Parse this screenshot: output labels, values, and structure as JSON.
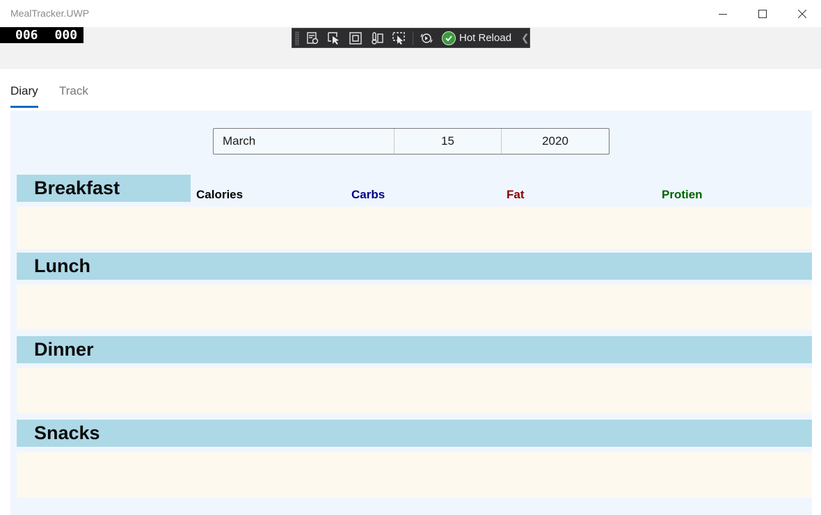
{
  "window": {
    "title": "MealTracker.UWP",
    "controls": [
      "minimize",
      "maximize",
      "close"
    ]
  },
  "frame_counter": {
    "left": "006",
    "right": "000"
  },
  "dev_toolbar": {
    "icons": [
      "live-visual-tree-icon",
      "select-element-icon",
      "display-layout-adorners-icon",
      "track-focus-icon",
      "binding-failures-icon",
      "hot-reload-status-icon"
    ],
    "hot_reload_label": "Hot Reload"
  },
  "tabs": [
    {
      "label": "Diary",
      "selected": true
    },
    {
      "label": "Track",
      "selected": false
    }
  ],
  "date_picker": {
    "month": "March",
    "day": "15",
    "year": "2020"
  },
  "columns": [
    {
      "label": "Calories",
      "color": "#000000"
    },
    {
      "label": "Carbs",
      "color": "#00008b"
    },
    {
      "label": "Fat",
      "color": "#8b0000"
    },
    {
      "label": "Protien",
      "color": "#006400"
    }
  ],
  "meals": [
    {
      "label": "Breakfast"
    },
    {
      "label": "Lunch"
    },
    {
      "label": "Dinner"
    },
    {
      "label": "Snacks"
    }
  ],
  "colors": {
    "meal_header": "#add8e6",
    "meal_body": "#fdf9ef",
    "content_background": "#eff6fd",
    "tab_accent": "#0a6bc5"
  }
}
